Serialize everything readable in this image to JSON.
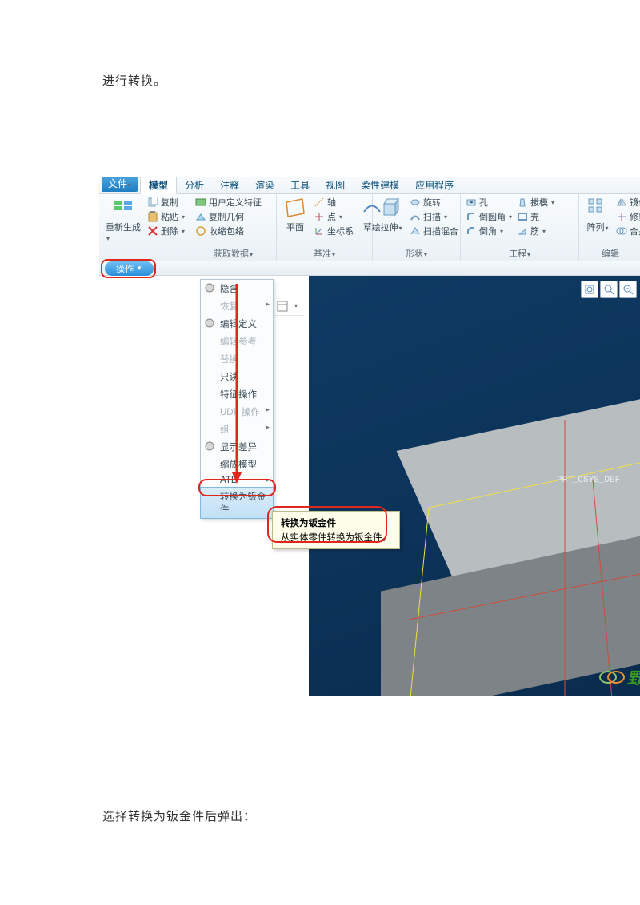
{
  "doc": {
    "intro": "进行转换。",
    "closing": "选择转换为钣金件后弹出："
  },
  "tabs": {
    "file": "文件",
    "items": [
      "模型",
      "分析",
      "注释",
      "渲染",
      "工具",
      "视图",
      "柔性建模",
      "应用程序"
    ],
    "active": "模型"
  },
  "ribbon": {
    "g1": {
      "regen": "重新生成",
      "copy": "复制",
      "paste": "粘贴",
      "delete": "删除",
      "op": "操作",
      "getdata": "获取数据"
    },
    "g2": {
      "udf": "用户定义特征",
      "copygeom": "复制几何",
      "shrink": "收缩包络"
    },
    "g3": {
      "title": "基准",
      "plane": "平面",
      "axis": "轴",
      "point": "点",
      "csys": "坐标系",
      "sketch": "草绘"
    },
    "g4": {
      "title": "形状",
      "extrude": "拉伸",
      "revolve": "旋转",
      "sweep": "扫描",
      "blend": "扫描混合"
    },
    "g5": {
      "title": "工程",
      "hole": "孔",
      "round": "倒圆角",
      "chamfer": "倒角",
      "draft": "拔模",
      "shell": "壳",
      "rib": "筋"
    },
    "g6": {
      "title": "编辑",
      "pattern": "阵列",
      "mirror": "镜像",
      "trim": "修剪",
      "merge": "合并"
    }
  },
  "dropdown": {
    "items": [
      {
        "label": "隐含",
        "icon": "hide-icon",
        "disabled": false
      },
      {
        "label": "恢复",
        "disabled": true,
        "sub": true
      },
      {
        "label": "编辑定义",
        "icon": "edit-icon",
        "disabled": false
      },
      {
        "label": "编辑参考",
        "disabled": true
      },
      {
        "label": "替换",
        "disabled": true
      },
      {
        "label": "只读",
        "disabled": false
      },
      {
        "label": "特征操作",
        "disabled": false
      },
      {
        "label": "UDF 操作",
        "disabled": true,
        "sub": true
      },
      {
        "label": "组",
        "disabled": true,
        "sub": true
      },
      {
        "label": "显示差异",
        "icon": "diff-icon",
        "disabled": false
      },
      {
        "label": "缩放模型",
        "disabled": false
      },
      {
        "label": "ATB",
        "disabled": false,
        "sub": true
      },
      {
        "label": "转换为钣金件",
        "disabled": false,
        "highlight": true
      }
    ]
  },
  "tooltip": {
    "title": "转换为钣金件",
    "body": "从实体零件转换为钣金件。"
  },
  "viewport": {
    "csys": "PRT_CSYS_DEF"
  },
  "watermark": {
    "text": "野"
  }
}
